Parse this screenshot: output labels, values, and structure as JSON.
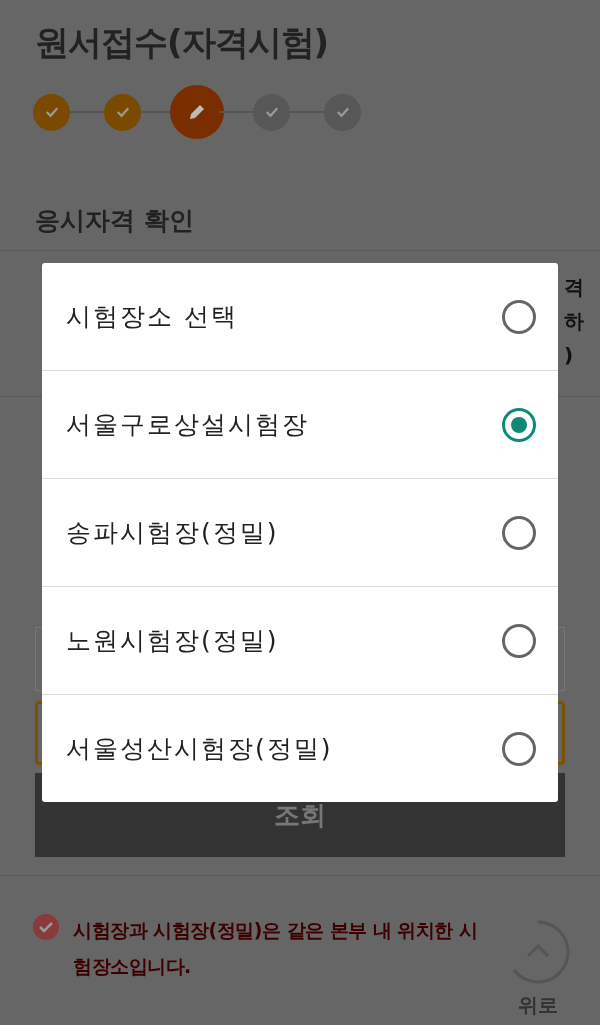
{
  "page": {
    "title": "원서접수(자격시험)",
    "steps": [
      {
        "kind": "done"
      },
      {
        "kind": "done"
      },
      {
        "kind": "current"
      },
      {
        "kind": "todo"
      },
      {
        "kind": "todo"
      }
    ],
    "section_title": "응시자격 확인",
    "side_fragments": [
      "격",
      "하",
      ")"
    ],
    "search_button": "조회",
    "notice": "시험장과 시험장(정밀)은 같은 본부 내 위치한 시험장소입니다.",
    "top_button": "위로"
  },
  "dialog": {
    "options": [
      {
        "label": "시험장소  선택",
        "selected": false
      },
      {
        "label": "서울구로상설시험장",
        "selected": true
      },
      {
        "label": "송파시험장(정밀)",
        "selected": false
      },
      {
        "label": "노원시험장(정밀)",
        "selected": false
      },
      {
        "label": "서울성산시험장(정밀)",
        "selected": false
      }
    ]
  }
}
